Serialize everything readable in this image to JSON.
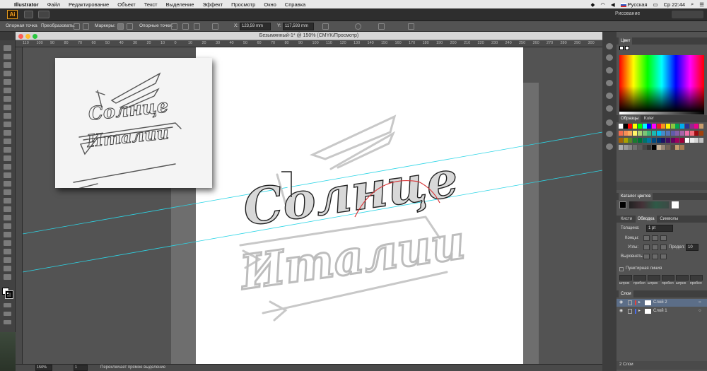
{
  "menubar": {
    "app": "Illustrator",
    "items": [
      "Файл",
      "Редактирование",
      "Объект",
      "Текст",
      "Выделение",
      "Эффект",
      "Просмотр",
      "Окно",
      "Справка"
    ],
    "keyboard": "Русская",
    "clock": "Ср 22:44"
  },
  "appbar": {
    "logo": "Ai",
    "workspace": "Рисование"
  },
  "control": {
    "anchor_label": "Опорная точка",
    "convert_label": "Преобразовать:",
    "markers_label": "Маркеры:",
    "anchors_label": "Опорные точки:",
    "x_label": "X:",
    "x_value": "123,59 mm",
    "y_label": "Y:",
    "y_value": "117,593 mm"
  },
  "document": {
    "title": "Безымянный-1* @ 150% (CMYK/Просмотр)"
  },
  "ruler": {
    "ticks": [
      "110",
      "100",
      "90",
      "80",
      "70",
      "60",
      "50",
      "40",
      "30",
      "20",
      "10",
      "0",
      "10",
      "20",
      "30",
      "40",
      "50",
      "60",
      "70",
      "80",
      "90",
      "100",
      "110",
      "120",
      "130",
      "140",
      "150",
      "160",
      "170",
      "180",
      "190",
      "200",
      "210",
      "220",
      "230",
      "240",
      "250",
      "260",
      "270",
      "280",
      "290",
      "300"
    ]
  },
  "status": {
    "zoom": "150%",
    "page": "1",
    "hint": "Переключает прямое выделение"
  },
  "artwork": {
    "line1": "Солнце",
    "line2": "Италии"
  },
  "panels": {
    "color": {
      "title": "Цвет"
    },
    "swatches": {
      "tabs": [
        "Образцы",
        "Kuler"
      ]
    },
    "catalog": {
      "title": "Каталог цветов"
    },
    "stroke": {
      "tabs": [
        "Кисти",
        "Обводка",
        "Символы"
      ],
      "weight_label": "Толщина:",
      "weight_value": "1 pt",
      "cap_label": "Концы:",
      "corner_label": "Углы:",
      "limit_label": "Предел:",
      "limit_value": "10",
      "align_label": "Выровнять:",
      "dashed_label": "Пунктирная линия",
      "dash_labels": [
        "штрих",
        "пробел",
        "штрих",
        "пробел",
        "штрих",
        "пробел"
      ]
    },
    "layers": {
      "title": "Слои",
      "items": [
        {
          "name": "Слой 2",
          "color": "#e4403c"
        },
        {
          "name": "Слой 1",
          "color": "#4a6df0"
        }
      ],
      "footer": "2 Слои"
    },
    "swatch_colors": [
      "#ffffff",
      "#000000",
      "#ff0000",
      "#ffff00",
      "#00ff00",
      "#00ffff",
      "#0000ff",
      "#ff00ff",
      "#ed1c24",
      "#f7941d",
      "#fff200",
      "#8dc63f",
      "#00a651",
      "#00aeef",
      "#2e3192",
      "#92278f",
      "#ec008c",
      "#c69c6d",
      "#f26c4f",
      "#f68e56",
      "#fbaf5d",
      "#fff568",
      "#acd373",
      "#7cc576",
      "#3bb878",
      "#1abbb4",
      "#00bff3",
      "#438ccb",
      "#5574b9",
      "#605ca8",
      "#855fa8",
      "#a763a8",
      "#f06ea9",
      "#f26d7d",
      "#9e0b0f",
      "#a0410d",
      "#a36209",
      "#aba000",
      "#598527",
      "#197b30",
      "#007236",
      "#00746b",
      "#0076a3",
      "#004b80",
      "#003471",
      "#1b1464",
      "#440e62",
      "#630460",
      "#9e005d",
      "#9e0039",
      "#ffffff",
      "#ebebeb",
      "#d6d6d6",
      "#c2c2c2",
      "#adadad",
      "#999999",
      "#858585",
      "#707070",
      "#5c5c5c",
      "#474747",
      "#333333",
      "#000000",
      "#c7b299",
      "#998675",
      "#736357",
      "#534741",
      "#c69c6d",
      "#a67c52"
    ]
  }
}
